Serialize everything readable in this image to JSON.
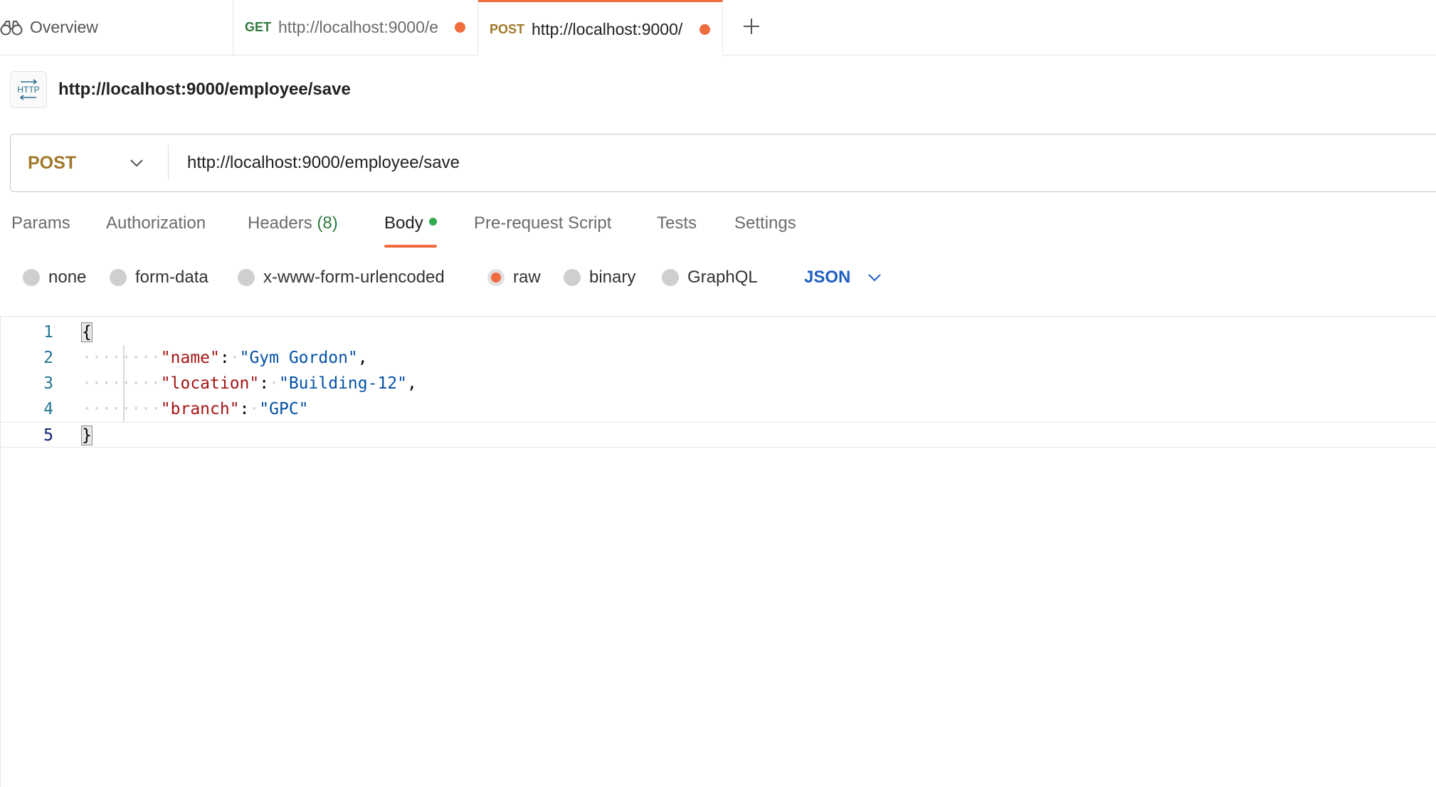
{
  "tabs": {
    "overview": {
      "label": "Overview"
    },
    "get_tab": {
      "method": "GET",
      "url": "http://localhost:9000/e"
    },
    "post_tab": {
      "method": "POST",
      "url": "http://localhost:9000/"
    }
  },
  "request": {
    "badge": "HTTP",
    "title": "http://localhost:9000/employee/save",
    "method": "POST",
    "url": "http://localhost:9000/employee/save"
  },
  "request_tabs": [
    {
      "label": "Params"
    },
    {
      "label": "Authorization"
    },
    {
      "label": "Headers",
      "count": "(8)"
    },
    {
      "label": "Body"
    },
    {
      "label": "Pre-request Script"
    },
    {
      "label": "Tests"
    },
    {
      "label": "Settings"
    }
  ],
  "body_types": [
    "none",
    "form-data",
    "x-www-form-urlencoded",
    "raw",
    "binary",
    "GraphQL"
  ],
  "body_type_selected": "raw",
  "body_format": "JSON",
  "editor": {
    "line_numbers": [
      "1",
      "2",
      "3",
      "4",
      "5"
    ],
    "open_brace": "{",
    "close_brace": "}",
    "fields": [
      {
        "key": "\"name\"",
        "value": "\"Gym Gordon\""
      },
      {
        "key": "\"location\"",
        "value": "\"Building-12\""
      },
      {
        "key": "\"branch\"",
        "value": "\"GPC\""
      }
    ]
  },
  "colors": {
    "accent": "#ef6c3f",
    "get_method": "#2f7a3e",
    "post_method": "#a0782a",
    "json_blue": "#1f5fc2"
  },
  "icons": [
    "binoculars-icon",
    "plus-icon",
    "http-icon",
    "chevron-down-icon"
  ]
}
